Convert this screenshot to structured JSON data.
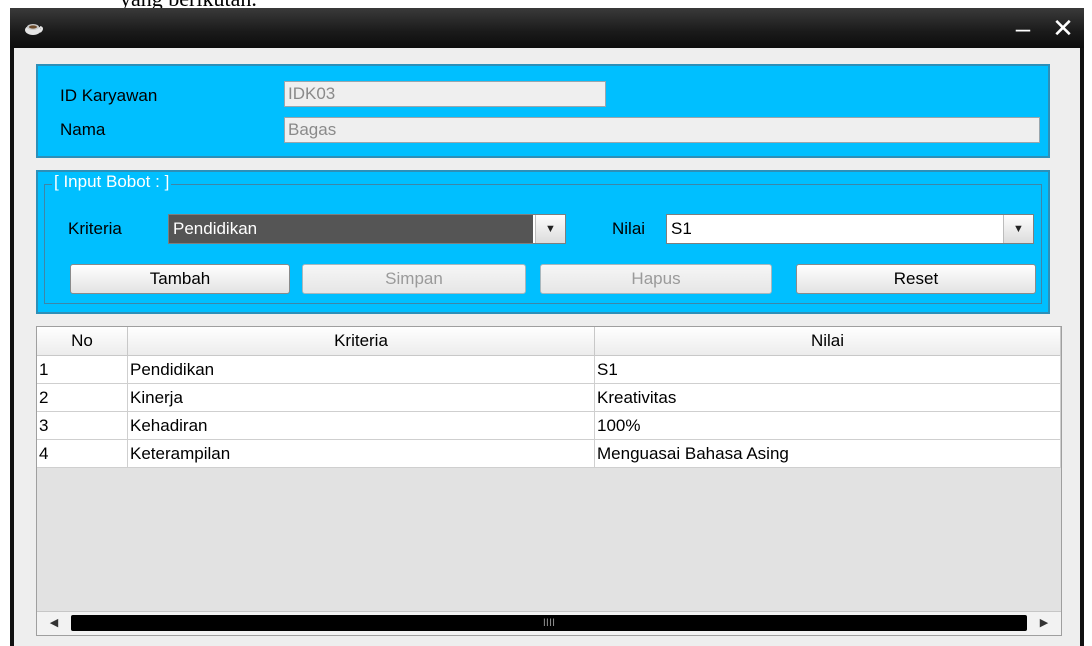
{
  "background_text": "yang berikutan.",
  "window": {
    "minimize_label": "–",
    "close_label": "✕",
    "icon": "coffee-cup-icon"
  },
  "form": {
    "id_label": "ID Karyawan",
    "id_value": "IDK03",
    "nama_label": "Nama",
    "nama_value": "Bagas"
  },
  "input_bobot": {
    "group_title": "[ Input Bobot : ]",
    "kriteria_label": "Kriteria",
    "kriteria_value": "Pendidikan",
    "nilai_label": "Nilai",
    "nilai_value": "S1",
    "buttons": {
      "tambah": "Tambah",
      "simpan": "Simpan",
      "hapus": "Hapus",
      "reset": "Reset"
    }
  },
  "table": {
    "headers": [
      "No",
      "Kriteria",
      "Nilai"
    ],
    "rows": [
      [
        "1",
        "Pendidikan",
        "S1"
      ],
      [
        "2",
        "Kinerja",
        "Kreativitas"
      ],
      [
        "3",
        "Kehadiran",
        "100%"
      ],
      [
        "4",
        "Keterampilan",
        "Menguasai Bahasa Asing"
      ]
    ]
  },
  "scrollbar": {
    "grip": "IIII",
    "left_arrow": "◀",
    "right_arrow": "▶"
  }
}
